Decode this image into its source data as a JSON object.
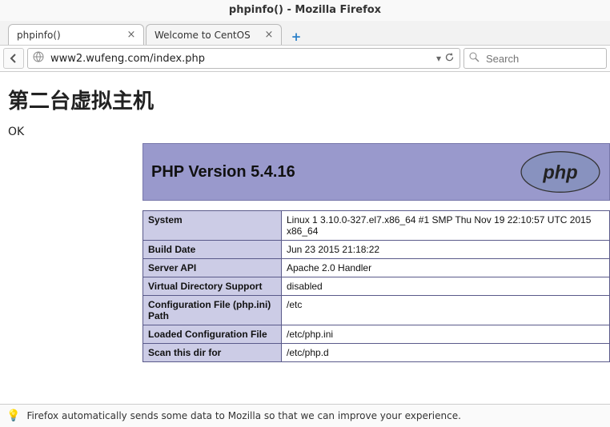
{
  "window": {
    "title": "phpinfo() - Mozilla Firefox"
  },
  "tabs": [
    {
      "label": "phpinfo()"
    },
    {
      "label": "Welcome to CentOS"
    }
  ],
  "navbar": {
    "url": "www2.wufeng.com/index.php",
    "search_placeholder": "Search"
  },
  "page": {
    "heading": "第二台虚拟主机",
    "ok": "OK"
  },
  "phpinfo": {
    "version_label": "PHP Version 5.4.16",
    "rows": [
      {
        "k": "System",
        "v": "Linux 1 3.10.0-327.el7.x86_64 #1 SMP Thu Nov 19 22:10:57 UTC 2015 x86_64"
      },
      {
        "k": "Build Date",
        "v": "Jun 23 2015 21:18:22"
      },
      {
        "k": "Server API",
        "v": "Apache 2.0 Handler"
      },
      {
        "k": "Virtual Directory Support",
        "v": "disabled"
      },
      {
        "k": "Configuration File (php.ini) Path",
        "v": "/etc"
      },
      {
        "k": "Loaded Configuration File",
        "v": "/etc/php.ini"
      },
      {
        "k": "Scan this dir for",
        "v": "/etc/php.d"
      }
    ]
  },
  "statusbar": {
    "message": "Firefox automatically sends some data to Mozilla so that we can improve your experience."
  }
}
